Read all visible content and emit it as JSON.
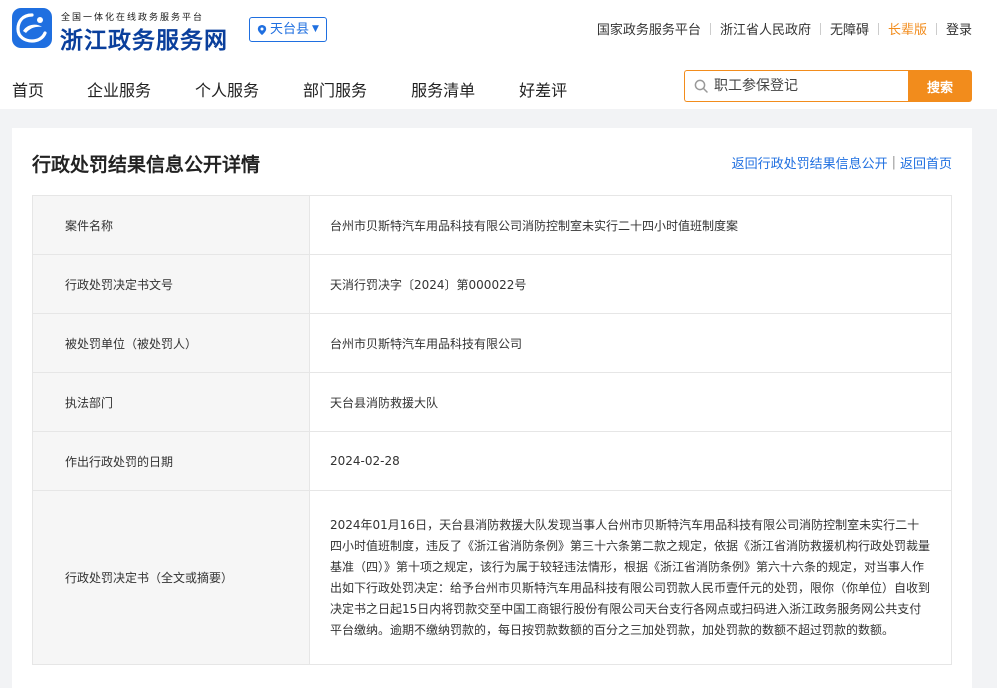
{
  "header": {
    "brand_sub": "全国一体化在线政务服务平台",
    "brand_main": "浙江政务服务网",
    "region": "天台县",
    "links": [
      "国家政务服务平台",
      "浙江省人民政府",
      "无障碍",
      "长辈版",
      "登录"
    ]
  },
  "nav": {
    "items": [
      "首页",
      "企业服务",
      "个人服务",
      "部门服务",
      "服务清单",
      "好差评"
    ]
  },
  "search": {
    "placeholder": "职工参保登记",
    "button": "搜索"
  },
  "card": {
    "title": "行政处罚结果信息公开详情",
    "back_link": "返回行政处罚结果信息公开",
    "home_link": "返回首页",
    "sep": "|",
    "rows": [
      {
        "label": "案件名称",
        "value": "台州市贝斯特汽车用品科技有限公司消防控制室未实行二十四小时值班制度案"
      },
      {
        "label": "行政处罚决定书文号",
        "value": "天消行罚决字〔2024〕第000022号"
      },
      {
        "label": "被处罚单位（被处罚人）",
        "value": "台州市贝斯特汽车用品科技有限公司"
      },
      {
        "label": "执法部门",
        "value": "天台县消防救援大队"
      },
      {
        "label": "作出行政处罚的日期",
        "value": "2024-02-28"
      },
      {
        "label": "行政处罚决定书（全文或摘要）",
        "value": "2024年01月16日，天台县消防救援大队发现当事人台州市贝斯特汽车用品科技有限公司消防控制室未实行二十四小时值班制度，违反了《浙江省消防条例》第三十六条第二款之规定，依据《浙江省消防救援机构行政处罚裁量基准（四）》第十项之规定，该行为属于较轻违法情形，根据《浙江省消防条例》第六十六条的规定，对当事人作出如下行政处罚决定：给予台州市贝斯特汽车用品科技有限公司罚款人民币壹仟元的处罚，限你（你单位）自收到决定书之日起15日内将罚款交至中国工商银行股份有限公司天台支行各网点或扫码进入浙江政务服务网公共支付平台缴纳。逾期不缴纳罚款的，每日按罚款数额的百分之三加处罚款，加处罚款的数额不超过罚款的数额。"
      }
    ]
  },
  "colors": {
    "brand_blue": "#1f6fe0",
    "brand_dark": "#0a3f9c",
    "accent_orange": "#f28c1c"
  },
  "icons": {
    "logo": "zhejiang-logo-icon",
    "region": "location-pin-icon",
    "caret": "caret-down-icon",
    "search": "search-icon"
  }
}
